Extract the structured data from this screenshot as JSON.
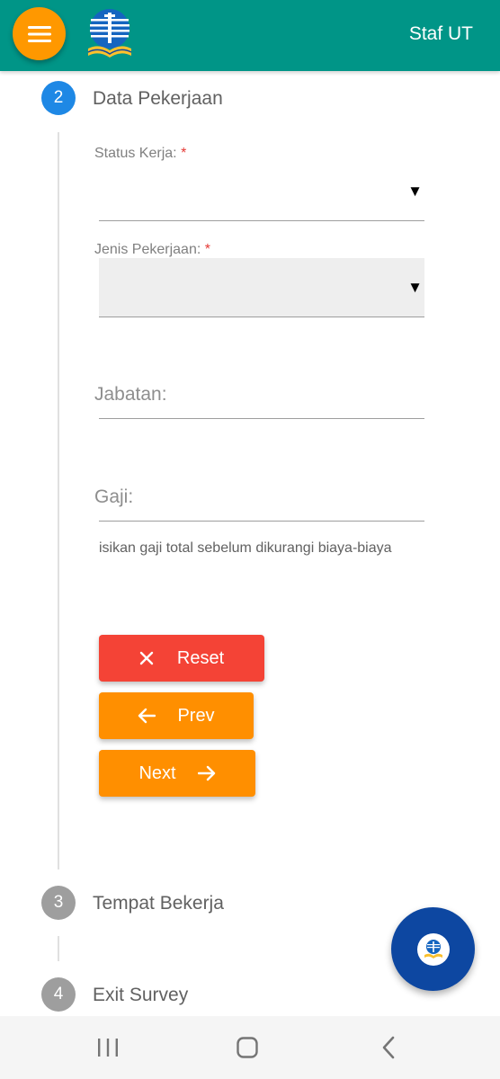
{
  "appbar": {
    "title": "Staf UT",
    "menu_icon": "menu-icon",
    "logo": "universitas-terbuka-logo",
    "color": "#009587",
    "menu_color": "#ff9800"
  },
  "steps": [
    {
      "number": "2",
      "title": "Data Pekerjaan",
      "state": "active"
    },
    {
      "number": "3",
      "title": "Tempat Bekerja",
      "state": "inactive"
    },
    {
      "number": "4",
      "title": "Exit Survey",
      "state": "inactive"
    }
  ],
  "form": {
    "status_kerja": {
      "label": "Status Kerja:",
      "required_mark": "*",
      "value": ""
    },
    "jenis_pekerjaan": {
      "label": "Jenis Pekerjaan:",
      "required_mark": "*",
      "value": ""
    },
    "jabatan": {
      "placeholder": "Jabatan:"
    },
    "gaji": {
      "placeholder": "Gaji:",
      "hint": "isikan gaji total sebelum dikurangi biaya-biaya"
    }
  },
  "buttons": {
    "reset": {
      "label": "Reset",
      "icon": "close-icon",
      "color": "#f44336"
    },
    "prev": {
      "label": "Prev",
      "icon": "arrow-left-icon",
      "color": "#ff8f00"
    },
    "next": {
      "label": "Next",
      "icon": "arrow-right-icon",
      "color": "#ff8f00"
    }
  },
  "fab": {
    "icon": "ut-logo-icon",
    "color": "#0d47a1"
  },
  "system_nav": {
    "icons": [
      "recent-apps-icon",
      "home-icon",
      "back-icon"
    ]
  }
}
